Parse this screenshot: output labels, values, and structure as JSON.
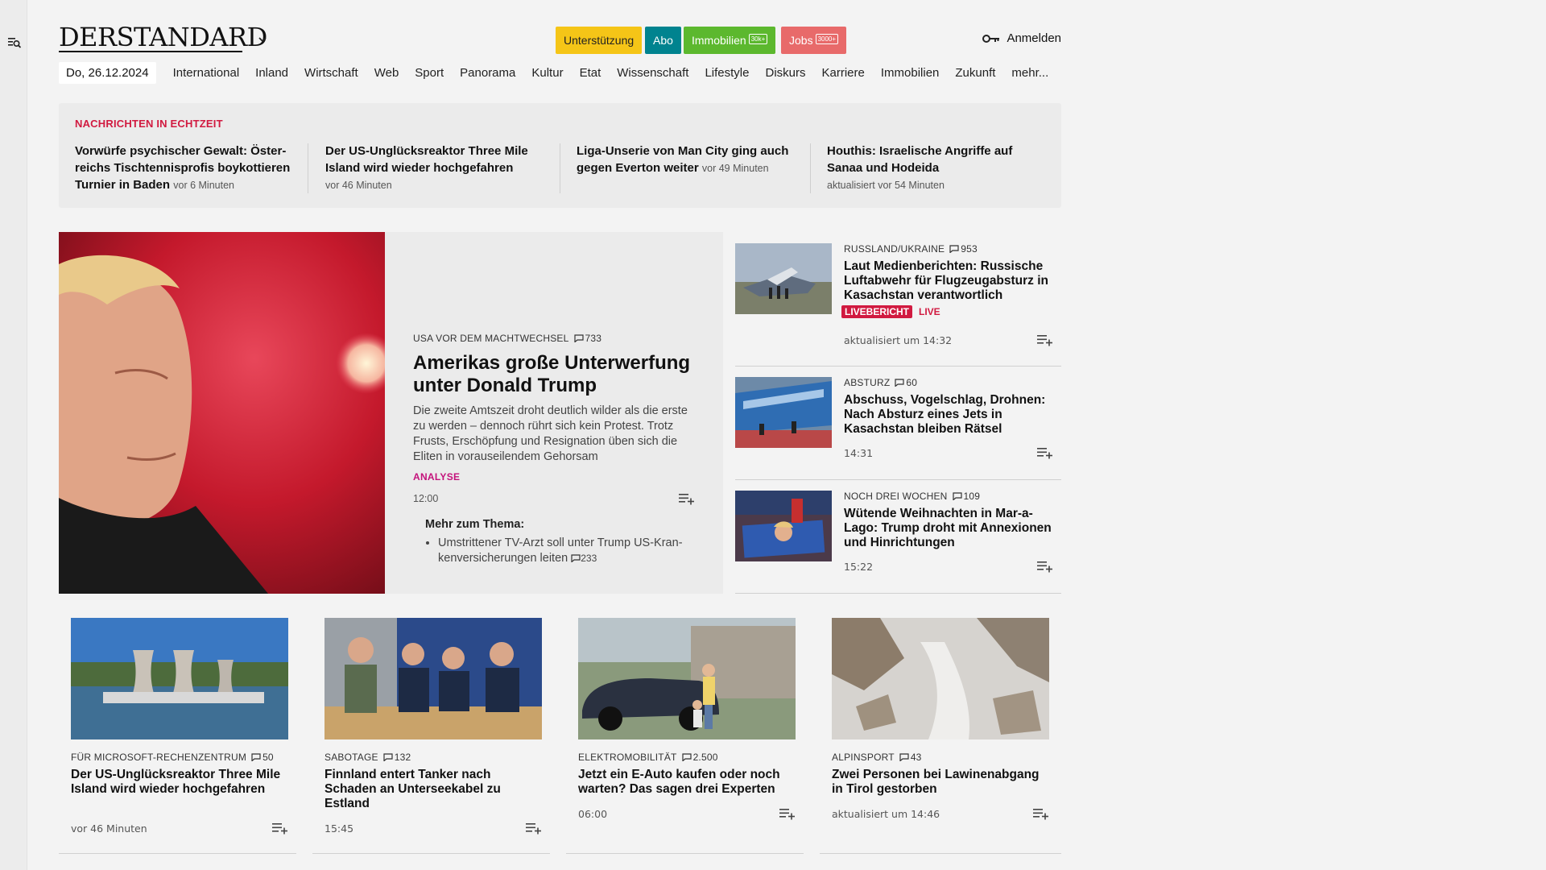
{
  "site": {
    "logo": "DERSTANDARD"
  },
  "header": {
    "promos": [
      {
        "label": "Unterstützung",
        "badge": "",
        "color": "#f5c517",
        "text_color": "#222"
      },
      {
        "label": "Abo",
        "badge": "",
        "color": "#00838f",
        "text_color": "#fff"
      },
      {
        "label": "Immobilien",
        "badge": "30k+",
        "color": "#5cb82e",
        "text_color": "#fff"
      },
      {
        "label": "Jobs",
        "badge": "3000+",
        "color": "#e86a6a",
        "text_color": "#fff"
      }
    ],
    "login_label": "Anmelden"
  },
  "nav": {
    "date": "Do, 26.12.2024",
    "items": [
      "International",
      "Inland",
      "Wirtschaft",
      "Web",
      "Sport",
      "Panorama",
      "Kultur",
      "Etat",
      "Wissenschaft",
      "Lifestyle",
      "Diskurs",
      "Karriere",
      "Immobilien",
      "Zukunft",
      "mehr..."
    ]
  },
  "ticker": {
    "title": "NACHRICHTEN IN ECHTZEIT",
    "items": [
      {
        "headline": "Vorwürfe psychischer Gewalt: Öster­reichs Tischtennisprofis boykottieren Turnier in Baden",
        "meta": "vor 6 Minuten"
      },
      {
        "headline": "Der US-Unglücksreaktor Three Mile Island wird wieder hochgefahren",
        "meta": "vor 46 Minuten"
      },
      {
        "headline": "Liga-Unserie von Man City ging auch gegen Everton weiter",
        "meta": "vor 49 Minuten"
      },
      {
        "headline": "Houthis: Israelische Angriffe auf Sanaa und Hodeida",
        "meta": "aktualisiert vor 54 Minuten"
      }
    ]
  },
  "hero": {
    "kicker": "USA VOR DEM MACHTWECHSEL",
    "comments": "733",
    "title": "Amerikas große Unterwerfung unter Donald Trump",
    "teaser": "Die zweite Amtszeit droht deutlich wilder als die erste zu werden – dennoch rührt sich kein Protest. Trotz Frusts, Erschöpfung und Resignation üben sich die Eliten in vorauseilendem Gehorsam",
    "tag": "ANALYSE",
    "time": "12:00",
    "more_title": "Mehr zum Thema:",
    "more_item": "Umstrittener TV-Arzt soll unter Trump US-Kran­kenversicherungen leiten",
    "more_comments": "233"
  },
  "side": [
    {
      "kicker": "RUSSLAND/UKRAINE",
      "comments": "953",
      "title": "Laut Medienberichten: Russische Luftabwehr für Flugzeugabsturz in Kasachstan verantwortlich",
      "live_badge": "LIVEBERICHT",
      "live_text": "LIVE",
      "time": "aktualisiert um 14:32"
    },
    {
      "kicker": "ABSTURZ",
      "comments": "60",
      "title": "Abschuss, Vogelschlag, Drohnen: Nach Absturz eines Jets in Kasachstan bleiben Rätsel",
      "time": "14:31"
    },
    {
      "kicker": "NOCH DREI WOCHEN",
      "comments": "109",
      "title": "Wütende Weihnachten in Mar-a-Lago: Trump droht mit Annexionen und Hinrichtungen",
      "time": "15:22"
    }
  ],
  "cards": [
    {
      "kicker": "FÜR MICROSOFT-RECHENZENTRUM",
      "comments": "50",
      "title": "Der US-Unglücksreaktor Three Mile Island wird wieder hochgefahren",
      "time": "vor 46 Minuten"
    },
    {
      "kicker": "SABOTAGE",
      "comments": "132",
      "title": "Finnland entert Tanker nach Schaden an Unterseekabel zu Estland",
      "time": "15:45"
    },
    {
      "kicker": "ELEKTROMOBILITÄT",
      "comments": "2.500",
      "title": "Jetzt ein E-Auto kaufen oder noch warten? Das sagen drei Experten",
      "time": "06:00"
    },
    {
      "kicker": "ALPINSPORT",
      "comments": "43",
      "title": "Zwei Personen bei Lawinenabgang in Tirol gestorben",
      "time": "aktualisiert um 14:46"
    }
  ]
}
